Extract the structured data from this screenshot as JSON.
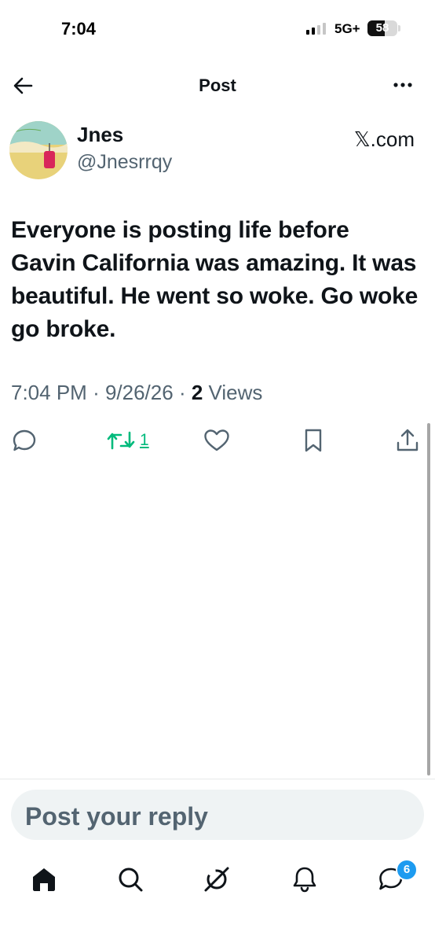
{
  "status_bar": {
    "time": "7:04",
    "network": "5G+",
    "battery": "58"
  },
  "header": {
    "title": "Post"
  },
  "author": {
    "name": "Jnes",
    "handle": "@Jnesrrqy",
    "source": "𝕏.com"
  },
  "tweet": {
    "text": "Everyone is posting life before Gavin California was amazing. It was beautiful. He went so woke. Go woke go broke.",
    "time": "7:04 PM",
    "date": "9/26/26",
    "views_count": "2",
    "views_label": "Views"
  },
  "actions": {
    "retweet_count": "1"
  },
  "reply": {
    "placeholder": "Post your reply"
  },
  "bottom_nav": {
    "messages_badge": "6"
  },
  "colors": {
    "accent": "#1d9bf0",
    "retweet": "#00ba7c",
    "secondary_text": "#536471"
  }
}
